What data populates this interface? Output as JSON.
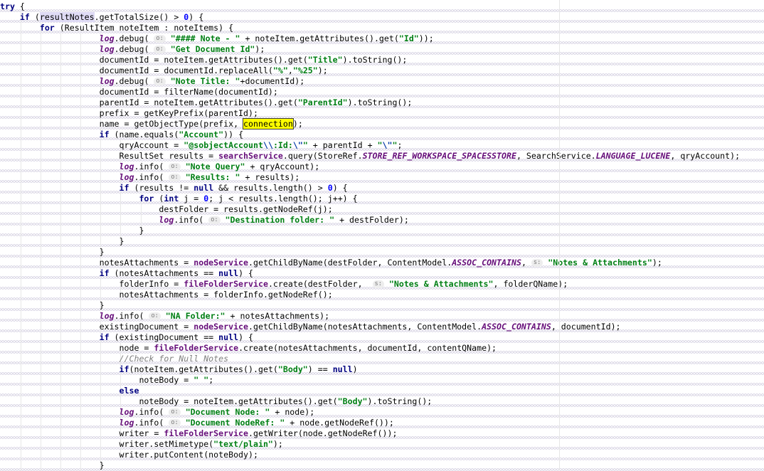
{
  "editor": {
    "language": "java",
    "theme": "light",
    "font_family_kind": "monospace",
    "right_margin_column_x": 786,
    "colors": {
      "background": "#ffffff",
      "default_text": "#000000",
      "keyword": "#000080",
      "string": "#007f14",
      "number": "#0000ff",
      "escape_sequence": "#0037a6",
      "field": "#660e7a",
      "static_field": "#660e7a",
      "comment": "#808080",
      "indent_guide": "#e8e8e8",
      "margin_guide": "#e6e6e6",
      "whitespace_marker": "#d9d5e4",
      "find_highlight_bg": "#ffff00",
      "find_highlight_border": "#3c3c3c",
      "identifier_highlight_bg": "#dfdbf5",
      "hint_bg": "#ededed",
      "hint_text": "#7a7a7a"
    },
    "highlights": {
      "find_occurrence_token": "connection",
      "identifier_under_caret": "resultNotes"
    },
    "inline_hints": [
      "o:",
      "s:"
    ]
  },
  "code_lines": [
    {
      "indent": 0,
      "tokens": [
        {
          "t": "try",
          "c": "kw"
        },
        {
          "t": " {",
          "c": "pl"
        }
      ]
    },
    {
      "indent": 1,
      "tokens": [
        {
          "t": "if",
          "c": "kw"
        },
        {
          "t": " (",
          "c": "pl"
        },
        {
          "t": "resultNotes",
          "c": "pl idhl"
        },
        {
          "t": ".getTotalSize() > ",
          "c": "pl"
        },
        {
          "t": "0",
          "c": "num"
        },
        {
          "t": ") {",
          "c": "pl"
        }
      ]
    },
    {
      "indent": 2,
      "tokens": [
        {
          "t": "for",
          "c": "kw"
        },
        {
          "t": " (ResultItem noteItem : noteItems) {",
          "c": "pl"
        }
      ]
    },
    {
      "indent": 5,
      "tokens": [
        {
          "t": "log",
          "c": "lgi"
        },
        {
          "t": ".debug( ",
          "c": "pl"
        },
        {
          "t": "o:",
          "c": "hint"
        },
        {
          "t": " ",
          "c": "pl"
        },
        {
          "t": "\"#### Note - \"",
          "c": "str"
        },
        {
          "t": " + noteItem.getAttributes().get(",
          "c": "pl"
        },
        {
          "t": "\"Id\"",
          "c": "str"
        },
        {
          "t": "));",
          "c": "pl"
        }
      ]
    },
    {
      "indent": 5,
      "tokens": [
        {
          "t": "log",
          "c": "lgi"
        },
        {
          "t": ".debug( ",
          "c": "pl"
        },
        {
          "t": "o:",
          "c": "hint"
        },
        {
          "t": " ",
          "c": "pl"
        },
        {
          "t": "\"Get Document Id\"",
          "c": "str"
        },
        {
          "t": ");",
          "c": "pl"
        }
      ]
    },
    {
      "indent": 5,
      "tokens": [
        {
          "t": "documentId = noteItem.getAttributes().get(",
          "c": "pl"
        },
        {
          "t": "\"Title\"",
          "c": "str"
        },
        {
          "t": ").toString();",
          "c": "pl"
        }
      ]
    },
    {
      "indent": 5,
      "tokens": [
        {
          "t": "documentId = documentId.replaceAll(",
          "c": "pl"
        },
        {
          "t": "\"%\"",
          "c": "str"
        },
        {
          "t": ",",
          "c": "pl"
        },
        {
          "t": "\"%25\"",
          "c": "str"
        },
        {
          "t": ");",
          "c": "pl"
        }
      ]
    },
    {
      "indent": 5,
      "tokens": [
        {
          "t": "log",
          "c": "lgi"
        },
        {
          "t": ".debug( ",
          "c": "pl"
        },
        {
          "t": "o:",
          "c": "hint"
        },
        {
          "t": " ",
          "c": "pl"
        },
        {
          "t": "\"Note Title: \"",
          "c": "str"
        },
        {
          "t": "+documentId);",
          "c": "pl"
        }
      ]
    },
    {
      "indent": 5,
      "tokens": [
        {
          "t": "documentId = filterName(documentId);",
          "c": "pl"
        }
      ]
    },
    {
      "indent": 5,
      "tokens": [
        {
          "t": "parentId = noteItem.getAttributes().get(",
          "c": "pl"
        },
        {
          "t": "\"ParentId\"",
          "c": "str"
        },
        {
          "t": ").toString();",
          "c": "pl"
        }
      ]
    },
    {
      "indent": 5,
      "tokens": [
        {
          "t": "prefix = getKeyPrefix(parentId);",
          "c": "pl"
        }
      ]
    },
    {
      "indent": 5,
      "tokens": [
        {
          "t": "name = getObjectType(prefix, ",
          "c": "pl"
        },
        {
          "t": "connection",
          "c": "pl findhl"
        },
        {
          "t": ");",
          "c": "pl"
        }
      ]
    },
    {
      "indent": 5,
      "tokens": [
        {
          "t": "if",
          "c": "kw"
        },
        {
          "t": " (name.equals(",
          "c": "pl"
        },
        {
          "t": "\"Account\"",
          "c": "str"
        },
        {
          "t": ")) {",
          "c": "pl"
        }
      ]
    },
    {
      "indent": 6,
      "tokens": [
        {
          "t": "qryAccount = ",
          "c": "pl"
        },
        {
          "t": "\"@sobjectAccount",
          "c": "str"
        },
        {
          "t": "\\\\",
          "c": "esc"
        },
        {
          "t": ":Id:",
          "c": "str"
        },
        {
          "t": "\\\"",
          "c": "esc"
        },
        {
          "t": "\"",
          "c": "str"
        },
        {
          "t": " + parentId + ",
          "c": "pl"
        },
        {
          "t": "\"",
          "c": "str"
        },
        {
          "t": "\\\"",
          "c": "esc"
        },
        {
          "t": "\"",
          "c": "str"
        },
        {
          "t": ";",
          "c": "pl"
        }
      ]
    },
    {
      "indent": 6,
      "tokens": [
        {
          "t": "ResultSet results = ",
          "c": "pl"
        },
        {
          "t": "searchService",
          "c": "fld"
        },
        {
          "t": ".query(StoreRef.",
          "c": "pl"
        },
        {
          "t": "STORE_REF_WORKSPACE_SPACESSTORE",
          "c": "stc"
        },
        {
          "t": ", SearchService.",
          "c": "pl"
        },
        {
          "t": "LANGUAGE_LUCENE",
          "c": "stc"
        },
        {
          "t": ", qryAccount);",
          "c": "pl"
        }
      ]
    },
    {
      "indent": 6,
      "tokens": [
        {
          "t": "log",
          "c": "lgi"
        },
        {
          "t": ".info( ",
          "c": "pl"
        },
        {
          "t": "o:",
          "c": "hint"
        },
        {
          "t": " ",
          "c": "pl"
        },
        {
          "t": "\"Note Query\"",
          "c": "str"
        },
        {
          "t": " + qryAccount);",
          "c": "pl"
        }
      ]
    },
    {
      "indent": 6,
      "tokens": [
        {
          "t": "log",
          "c": "lgi"
        },
        {
          "t": ".info( ",
          "c": "pl"
        },
        {
          "t": "o:",
          "c": "hint"
        },
        {
          "t": " ",
          "c": "pl"
        },
        {
          "t": "\"Results: \"",
          "c": "str"
        },
        {
          "t": " + results);",
          "c": "pl"
        }
      ]
    },
    {
      "indent": 6,
      "tokens": [
        {
          "t": "if",
          "c": "kw"
        },
        {
          "t": " (results != ",
          "c": "pl"
        },
        {
          "t": "null",
          "c": "kw"
        },
        {
          "t": " && results.length() > ",
          "c": "pl"
        },
        {
          "t": "0",
          "c": "num"
        },
        {
          "t": ") {",
          "c": "pl"
        }
      ]
    },
    {
      "indent": 7,
      "tokens": [
        {
          "t": "for",
          "c": "kw"
        },
        {
          "t": " (",
          "c": "pl"
        },
        {
          "t": "int",
          "c": "kw"
        },
        {
          "t": " j = ",
          "c": "pl"
        },
        {
          "t": "0",
          "c": "num"
        },
        {
          "t": "; j < results.length(); j++) {",
          "c": "pl"
        }
      ]
    },
    {
      "indent": 8,
      "tokens": [
        {
          "t": "destFolder = results.getNodeRef(j);",
          "c": "pl"
        }
      ]
    },
    {
      "indent": 8,
      "tokens": [
        {
          "t": "log",
          "c": "lgi"
        },
        {
          "t": ".info( ",
          "c": "pl"
        },
        {
          "t": "o:",
          "c": "hint"
        },
        {
          "t": " ",
          "c": "pl"
        },
        {
          "t": "\"Destination folder: \"",
          "c": "str"
        },
        {
          "t": " + destFolder);",
          "c": "pl"
        }
      ]
    },
    {
      "indent": 7,
      "tokens": [
        {
          "t": "}",
          "c": "pl"
        }
      ]
    },
    {
      "indent": 6,
      "tokens": [
        {
          "t": "}",
          "c": "pl"
        }
      ]
    },
    {
      "indent": 5,
      "tokens": [
        {
          "t": "}",
          "c": "pl"
        }
      ]
    },
    {
      "indent": 5,
      "tokens": [
        {
          "t": "notesAttachments = ",
          "c": "pl"
        },
        {
          "t": "nodeService",
          "c": "fld"
        },
        {
          "t": ".getChildByName(destFolder, ContentModel.",
          "c": "pl"
        },
        {
          "t": "ASSOC_CONTAINS",
          "c": "stc"
        },
        {
          "t": ", ",
          "c": "pl"
        },
        {
          "t": "s:",
          "c": "hint"
        },
        {
          "t": " ",
          "c": "pl"
        },
        {
          "t": "\"Notes & Attachments\"",
          "c": "str"
        },
        {
          "t": ");",
          "c": "pl"
        }
      ]
    },
    {
      "indent": 5,
      "tokens": [
        {
          "t": "if",
          "c": "kw"
        },
        {
          "t": " (notesAttachments == ",
          "c": "pl"
        },
        {
          "t": "null",
          "c": "kw"
        },
        {
          "t": ") {",
          "c": "pl"
        }
      ]
    },
    {
      "indent": 6,
      "tokens": [
        {
          "t": "folderInfo = ",
          "c": "pl"
        },
        {
          "t": "fileFolderService",
          "c": "fld"
        },
        {
          "t": ".create(destFolder,  ",
          "c": "pl"
        },
        {
          "t": "s:",
          "c": "hint"
        },
        {
          "t": " ",
          "c": "pl"
        },
        {
          "t": "\"Notes & Attachments\"",
          "c": "str"
        },
        {
          "t": ", folderQName);",
          "c": "pl"
        }
      ]
    },
    {
      "indent": 6,
      "tokens": [
        {
          "t": "notesAttachments = folderInfo.getNodeRef();",
          "c": "pl"
        }
      ]
    },
    {
      "indent": 5,
      "tokens": [
        {
          "t": "}",
          "c": "pl"
        }
      ]
    },
    {
      "indent": 5,
      "tokens": [
        {
          "t": "log",
          "c": "lgi"
        },
        {
          "t": ".info( ",
          "c": "pl"
        },
        {
          "t": "o:",
          "c": "hint"
        },
        {
          "t": " ",
          "c": "pl"
        },
        {
          "t": "\"NA Folder:\"",
          "c": "str"
        },
        {
          "t": " + notesAttachments);",
          "c": "pl"
        }
      ]
    },
    {
      "indent": 5,
      "tokens": [
        {
          "t": "existingDocument = ",
          "c": "pl"
        },
        {
          "t": "nodeService",
          "c": "fld"
        },
        {
          "t": ".getChildByName(notesAttachments, ContentModel.",
          "c": "pl"
        },
        {
          "t": "ASSOC_CONTAINS",
          "c": "stc"
        },
        {
          "t": ", documentId);",
          "c": "pl"
        }
      ]
    },
    {
      "indent": 5,
      "tokens": [
        {
          "t": "if",
          "c": "kw"
        },
        {
          "t": " (existingDocument == ",
          "c": "pl"
        },
        {
          "t": "null",
          "c": "kw"
        },
        {
          "t": ") {",
          "c": "pl"
        }
      ]
    },
    {
      "indent": 6,
      "tokens": [
        {
          "t": "node = ",
          "c": "pl"
        },
        {
          "t": "fileFolderService",
          "c": "fld"
        },
        {
          "t": ".create(notesAttachments, documentId, contentQName);",
          "c": "pl"
        }
      ]
    },
    {
      "indent": 6,
      "tokens": [
        {
          "t": "//Check for Null Notes",
          "c": "cmt"
        }
      ]
    },
    {
      "indent": 6,
      "tokens": [
        {
          "t": "if",
          "c": "kw"
        },
        {
          "t": "(noteItem.getAttributes().get(",
          "c": "pl"
        },
        {
          "t": "\"Body\"",
          "c": "str"
        },
        {
          "t": ") == ",
          "c": "pl"
        },
        {
          "t": "null",
          "c": "kw"
        },
        {
          "t": ")",
          "c": "pl"
        }
      ]
    },
    {
      "indent": 7,
      "tokens": [
        {
          "t": "noteBody = ",
          "c": "pl"
        },
        {
          "t": "\" \"",
          "c": "str"
        },
        {
          "t": ";",
          "c": "pl"
        }
      ]
    },
    {
      "indent": 6,
      "tokens": [
        {
          "t": "else",
          "c": "kw"
        }
      ]
    },
    {
      "indent": 7,
      "tokens": [
        {
          "t": "noteBody = noteItem.getAttributes().get(",
          "c": "pl"
        },
        {
          "t": "\"Body\"",
          "c": "str"
        },
        {
          "t": ").toString();",
          "c": "pl"
        }
      ]
    },
    {
      "indent": 6,
      "tokens": [
        {
          "t": "log",
          "c": "lgi"
        },
        {
          "t": ".info( ",
          "c": "pl"
        },
        {
          "t": "o:",
          "c": "hint"
        },
        {
          "t": " ",
          "c": "pl"
        },
        {
          "t": "\"Document Node: \"",
          "c": "str"
        },
        {
          "t": " + node);",
          "c": "pl"
        }
      ]
    },
    {
      "indent": 6,
      "tokens": [
        {
          "t": "log",
          "c": "lgi"
        },
        {
          "t": ".info( ",
          "c": "pl"
        },
        {
          "t": "o:",
          "c": "hint"
        },
        {
          "t": " ",
          "c": "pl"
        },
        {
          "t": "\"Document NodeRef: \"",
          "c": "str"
        },
        {
          "t": " + node.getNodeRef());",
          "c": "pl"
        }
      ]
    },
    {
      "indent": 6,
      "tokens": [
        {
          "t": "writer = ",
          "c": "pl"
        },
        {
          "t": "fileFolderService",
          "c": "fld"
        },
        {
          "t": ".getWriter(node.getNodeRef());",
          "c": "pl"
        }
      ]
    },
    {
      "indent": 6,
      "tokens": [
        {
          "t": "writer.setMimetype(",
          "c": "pl"
        },
        {
          "t": "\"text/plain\"",
          "c": "str"
        },
        {
          "t": ");",
          "c": "pl"
        }
      ]
    },
    {
      "indent": 6,
      "tokens": [
        {
          "t": "writer.putContent(noteBody);",
          "c": "pl"
        }
      ]
    },
    {
      "indent": 5,
      "tokens": [
        {
          "t": "}",
          "c": "pl"
        }
      ]
    }
  ]
}
